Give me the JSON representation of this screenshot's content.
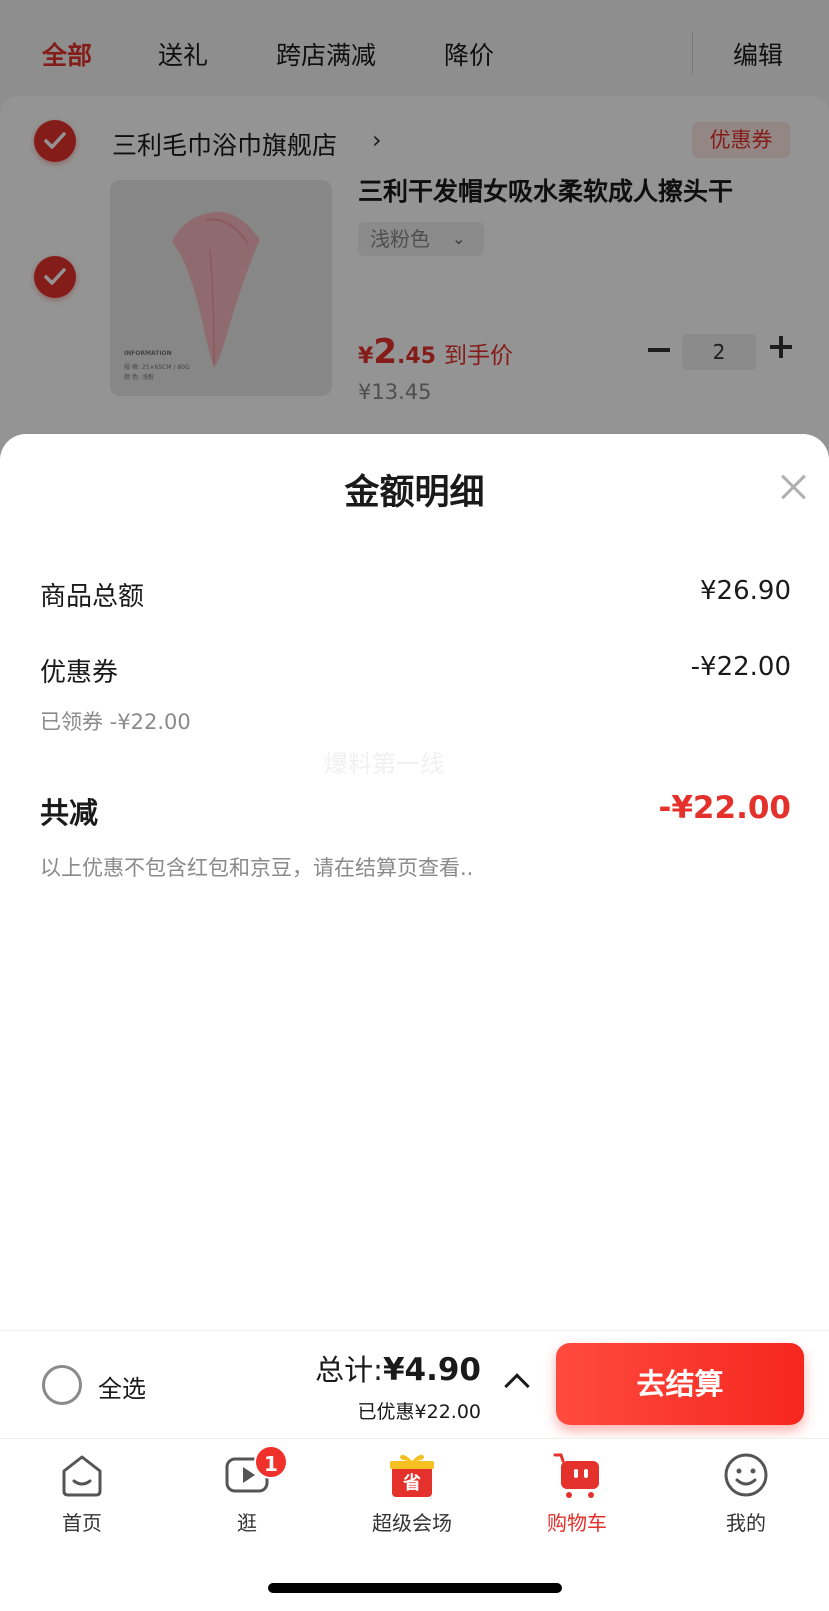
{
  "tabs": [
    {
      "label": "全部",
      "active": true
    },
    {
      "label": "送礼",
      "active": false
    },
    {
      "label": "跨店满减",
      "active": false
    },
    {
      "label": "降价",
      "active": false
    }
  ],
  "edit_label": "编辑",
  "shop": {
    "name": "三利毛巾浴巾旗舰店",
    "arrow": "›",
    "coupon_tag": "优惠券",
    "product": {
      "title": "三利干发帽女吸水柔软成人擦头干",
      "spec": "浅粉色",
      "spec_chevron": "⌄",
      "image_text": [
        "INFORMATION",
        "规  格: 25×65CM / 80G",
        "颜  色: 浅粉"
      ],
      "price_symbol": "¥",
      "price_int": "2",
      "price_dec": ".45",
      "price_label": "到手价",
      "original_price": "¥13.45",
      "quantity": "2"
    }
  },
  "sheet": {
    "title": "金额明细",
    "rows": {
      "goods_total": {
        "label": "商品总额",
        "value": "¥26.90"
      },
      "coupon": {
        "label": "优惠券",
        "value": "-¥22.00",
        "sub": "已领券 -¥22.00"
      },
      "total_reduce": {
        "label": "共减",
        "value": "-¥22.00"
      }
    },
    "note": "以上优惠不包含红包和京豆，请在结算页查看..",
    "watermark": "爆料第一线"
  },
  "checkout": {
    "select_all": "全选",
    "total_label": "总计:",
    "total_amount": "¥4.90",
    "saved": "已优惠¥22.00",
    "button": "去结算"
  },
  "nav": {
    "items": [
      {
        "label": "首页",
        "icon": "home-icon"
      },
      {
        "label": "逛",
        "icon": "video-play-icon"
      },
      {
        "label": "超级会场",
        "icon": "gift-save-icon"
      },
      {
        "label": "购物车",
        "icon": "cart-icon"
      },
      {
        "label": "我的",
        "icon": "profile-smile-icon"
      }
    ],
    "badge": "1"
  },
  "colors": {
    "accent": "#e4312b",
    "button": "#f5261e"
  }
}
